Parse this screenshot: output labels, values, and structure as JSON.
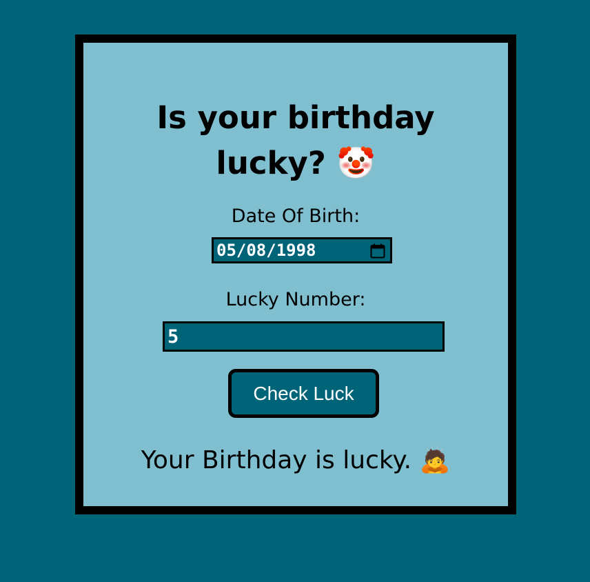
{
  "title": {
    "line1": "Is your birthday",
    "line2": "lucky?",
    "emoji": "🤡"
  },
  "form": {
    "dob_label": "Date Of Birth:",
    "dob_value": "05/08/1998",
    "lucky_label": "Lucky Number:",
    "lucky_value": "5",
    "submit_label": "Check Luck"
  },
  "result": {
    "text": "Your Birthday is lucky.",
    "emoji": "🙇"
  },
  "icons": {
    "date_picker": "calendar-icon"
  },
  "colors": {
    "page_background": "#006479",
    "card_background": "#80bfd0",
    "border": "#000000",
    "field_background": "#006479",
    "field_text": "#ffffff"
  }
}
